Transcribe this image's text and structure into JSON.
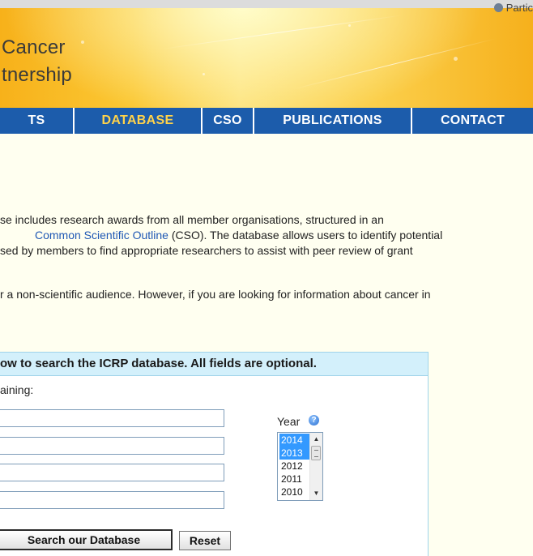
{
  "header": {
    "partner_link": "Partic",
    "brand_line1": "Cancer",
    "brand_line2": "tnership"
  },
  "nav": {
    "items": [
      {
        "label": "TS"
      },
      {
        "label": "DATABASE"
      },
      {
        "label": "CSO"
      },
      {
        "label": "PUBLICATIONS"
      },
      {
        "label": "CONTACT"
      }
    ],
    "active_index": 1
  },
  "intro": {
    "p1_line1": "se includes research awards from all member organisations, structured in an",
    "p1_line2_link": "Common Scientific Outline",
    "p1_line2_rest": " (CSO). The database allows users to identify potential",
    "p1_line3": "sed by members to find appropriate researchers to assist with peer review of grant",
    "p2_line1": "r a non-scientific audience. However, if you are looking for information about cancer in"
  },
  "search": {
    "heading": "ow to search the ICRP database. All fields are optional.",
    "subheading": "aining:",
    "fields": [
      {
        "value": ""
      },
      {
        "value": ""
      },
      {
        "value": ""
      },
      {
        "value": ""
      }
    ],
    "year_label": "Year",
    "help_glyph": "?",
    "years": [
      {
        "label": "2014",
        "selected": true
      },
      {
        "label": "2013",
        "selected": true
      },
      {
        "label": "2012",
        "selected": false
      },
      {
        "label": "2011",
        "selected": false
      },
      {
        "label": "2010",
        "selected": false
      }
    ],
    "submit_label": "Search our Database",
    "reset_label": "Reset"
  },
  "colors": {
    "nav_bg": "#1c5cab",
    "nav_active": "#ffd24a",
    "link": "#1f58b4",
    "panel_head_bg": "#d3f0fb",
    "page_bg": "#fffff0",
    "selection": "#3399ff"
  },
  "icons": {
    "partner": "globe-icon",
    "help": "help-icon",
    "scroll_up": "scroll-up-icon",
    "scroll_down": "scroll-down-icon"
  }
}
